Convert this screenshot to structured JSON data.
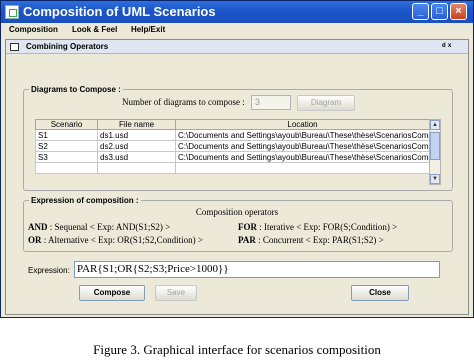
{
  "window": {
    "title": "Composition of UML Scenarios",
    "minimize": "_",
    "maximize": "□",
    "close": "×"
  },
  "menu": [
    "Composition",
    "Look & Feel",
    "Help/Exit"
  ],
  "inner_window": {
    "title": "Combining Operators",
    "controls": "ᵈ ˣ"
  },
  "diagrams": {
    "group_label": "Diagrams to Compose :",
    "count_label": "Number of diagrams to compose :",
    "count_value": "3",
    "diagram_button": "Diagram",
    "columns": [
      "Scenario",
      "File name",
      "Location"
    ],
    "rows": [
      [
        "S1",
        "ds1.usd",
        "C:\\Documents and Settings\\ayoub\\Bureau\\These\\thèse\\ScenariosCompo..."
      ],
      [
        "S2",
        "ds2.usd",
        "C:\\Documents and Settings\\ayoub\\Bureau\\These\\thèse\\ScenariosCompo..."
      ],
      [
        "S3",
        "ds3.usd",
        "C:\\Documents and Settings\\ayoub\\Bureau\\These\\thèse\\ScenariosCompo..."
      ]
    ]
  },
  "composition": {
    "group_label": "Expression of composition :",
    "ops_title": "Composition operators",
    "and": {
      "kw": "AND",
      "text": ": Sequenal  < Exp: AND(S1;S2) >"
    },
    "or": {
      "kw": "OR",
      "text": ": Alternative < Exp: OR(S1;S2,Condition) >"
    },
    "for": {
      "kw": "FOR",
      "text": ": Iterative        < Exp: FOR(S;Condition) >"
    },
    "par": {
      "kw": "PAR",
      "text": ": Concurrent < Exp: PAR(S1;S2) >"
    },
    "expr_label": "Expression:",
    "expr_value": "PAR{S1;OR{S2;S3;Price>1000}}"
  },
  "buttons": {
    "compose": "Compose",
    "save": "Save",
    "close": "Close"
  },
  "caption": "Figure 3.   Graphical interface for scenarios composition"
}
